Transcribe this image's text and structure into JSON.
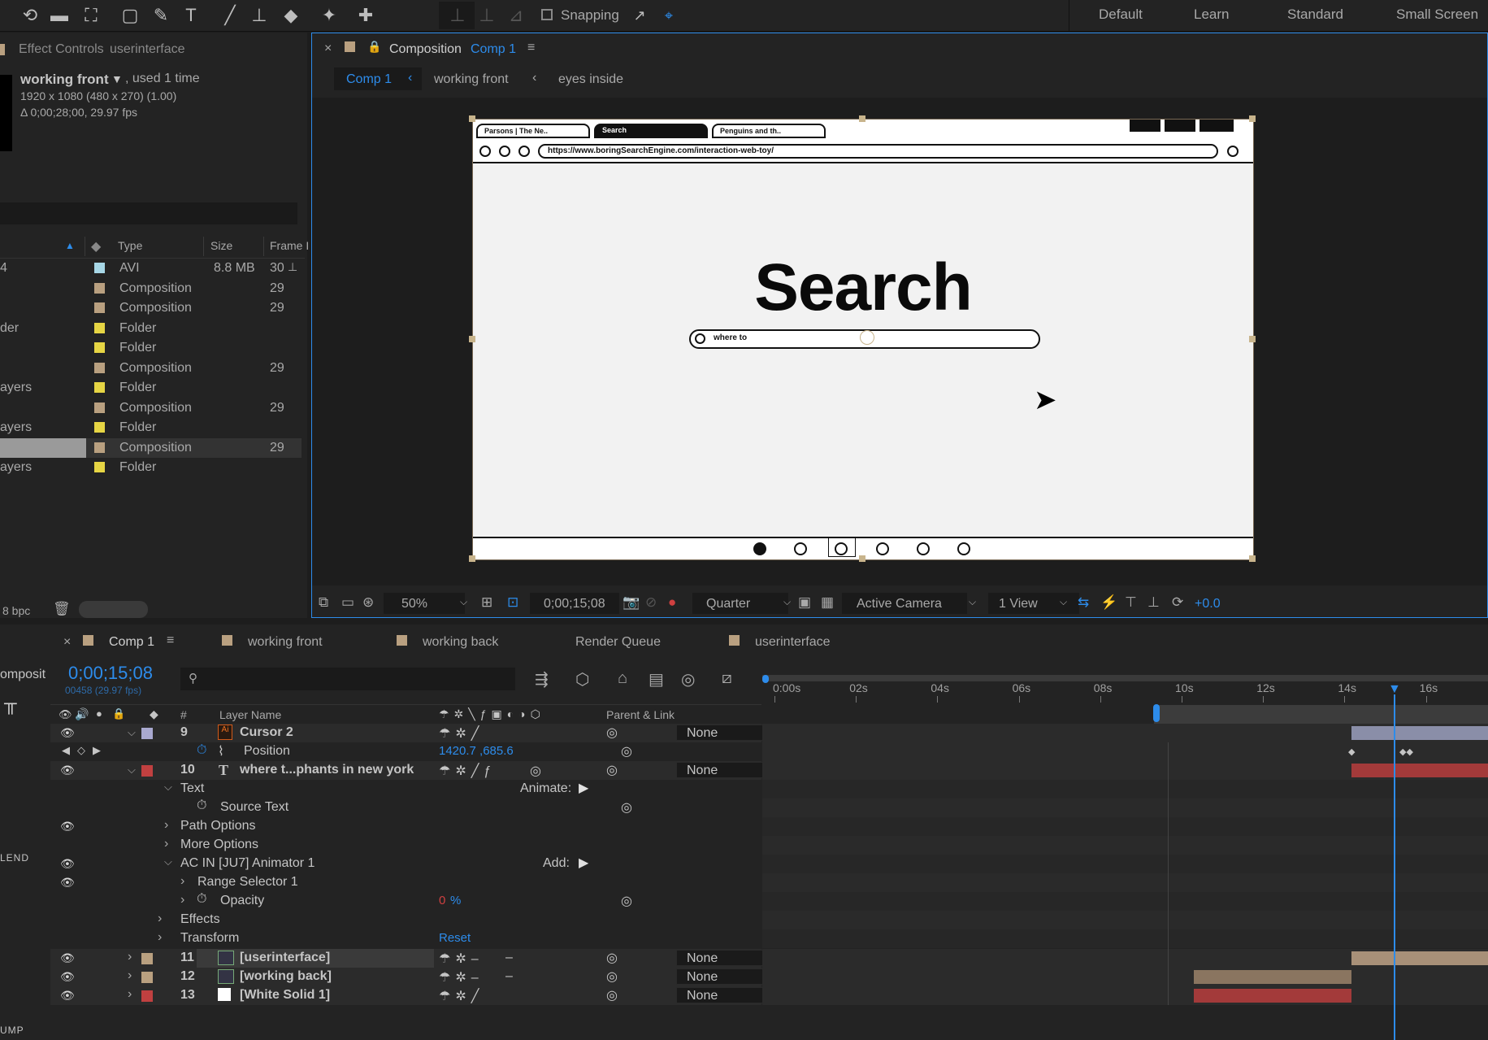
{
  "toolbar": {
    "snapping_label": "Snapping",
    "workspaces": [
      "Default",
      "Learn",
      "Standard",
      "Small Screen"
    ]
  },
  "effect_controls": {
    "title": "Effect Controls",
    "layer": "userinterface",
    "item_name": "working front",
    "used": ", used 1 time",
    "dims": "1920 x 1080  (480 x 270) (1.00)",
    "duration": "Δ 0;00;28;00, 29.97 fps"
  },
  "project": {
    "columns": {
      "type": "Type",
      "size": "Size",
      "frame": "Frame I"
    },
    "items": [
      {
        "name": "4",
        "type": "AVI",
        "size": "8.8 MB",
        "frame": "30",
        "color": "#a7d7e6"
      },
      {
        "name": "",
        "type": "Composition",
        "size": "",
        "frame": "29",
        "color": "#b9a080"
      },
      {
        "name": "",
        "type": "Composition",
        "size": "",
        "frame": "29",
        "color": "#b9a080"
      },
      {
        "name": "der",
        "type": "Folder",
        "size": "",
        "frame": "",
        "color": "#e6d544"
      },
      {
        "name": "",
        "type": "Folder",
        "size": "",
        "frame": "",
        "color": "#e6d544"
      },
      {
        "name": "",
        "type": "Composition",
        "size": "",
        "frame": "29",
        "color": "#b9a080"
      },
      {
        "name": "ayers",
        "type": "Folder",
        "size": "",
        "frame": "",
        "color": "#e6d544"
      },
      {
        "name": "",
        "type": "Composition",
        "size": "",
        "frame": "29",
        "color": "#b9a080"
      },
      {
        "name": "ayers",
        "type": "Folder",
        "size": "",
        "frame": "",
        "color": "#e6d544"
      },
      {
        "name": "",
        "type": "Composition",
        "size": "",
        "frame": "29",
        "color": "#b9a080"
      },
      {
        "name": "ayers",
        "type": "Folder",
        "size": "",
        "frame": "",
        "color": "#e6d544"
      }
    ],
    "bpc": "8 bpc"
  },
  "composition": {
    "panel_label": "Composition",
    "comp_name": "Comp 1",
    "breadcrumbs": [
      "Comp 1",
      "working front",
      "eyes inside"
    ],
    "mock": {
      "tabs": [
        "Parsons | The Ne..",
        "Search",
        "Penguins and th.."
      ],
      "url": "https://www.boringSearchEngine.com/interaction-web-toy/",
      "heading": "Search",
      "search_placeholder": "where to"
    },
    "viewer_bar": {
      "zoom": "50%",
      "timecode": "0;00;15;08",
      "resolution": "Quarter",
      "camera": "Active Camera",
      "views": "1 View",
      "exposure": "+0.0"
    }
  },
  "timeline": {
    "tabs": [
      "Comp 1",
      "working front",
      "working back",
      "Render Queue",
      "userinterface"
    ],
    "timecode": "0;00;15;08",
    "frames": "00458 (29.97 fps)",
    "left_cut_label": "omposit",
    "columns": {
      "num": "#",
      "layer_name": "Layer Name",
      "parent": "Parent & Link"
    },
    "ruler": [
      "0:00s",
      "02s",
      "04s",
      "06s",
      "08s",
      "10s",
      "12s",
      "14s",
      "16s"
    ],
    "rows": {
      "l9": {
        "num": "9",
        "name": "Cursor 2",
        "parent": "None"
      },
      "position": {
        "label": "Position",
        "value": "1420.7 ,685.6"
      },
      "l10": {
        "num": "10",
        "name": "where t...phants in new york",
        "parent": "None"
      },
      "text": {
        "label": "Text",
        "animate": "Animate:"
      },
      "source_text": "Source Text",
      "path_options": "Path Options",
      "more_options": "More Options",
      "animator": {
        "label": "AC IN [JU7] Animator 1",
        "add": "Add:"
      },
      "range_selector": "Range Selector 1",
      "opacity": {
        "label": "Opacity",
        "value": "0",
        "unit": "%"
      },
      "effects": "Effects",
      "transform": {
        "label": "Transform",
        "reset": "Reset"
      },
      "l11": {
        "num": "11",
        "name": "[userinterface]",
        "parent": "None"
      },
      "l12": {
        "num": "12",
        "name": "[working back]",
        "parent": "None"
      },
      "l13": {
        "num": "13",
        "name": "[White Solid 1]",
        "parent": "None"
      }
    },
    "left_labels": [
      "LEND",
      "UMP"
    ]
  },
  "colors": {
    "accent": "#2d8ceb",
    "bar_cursor": "#8a8ea8",
    "bar_text": "#a33a3a",
    "bar_ui": "#a89078",
    "bar_back": "#8a7560",
    "bar_solid": "#a33a3a"
  }
}
